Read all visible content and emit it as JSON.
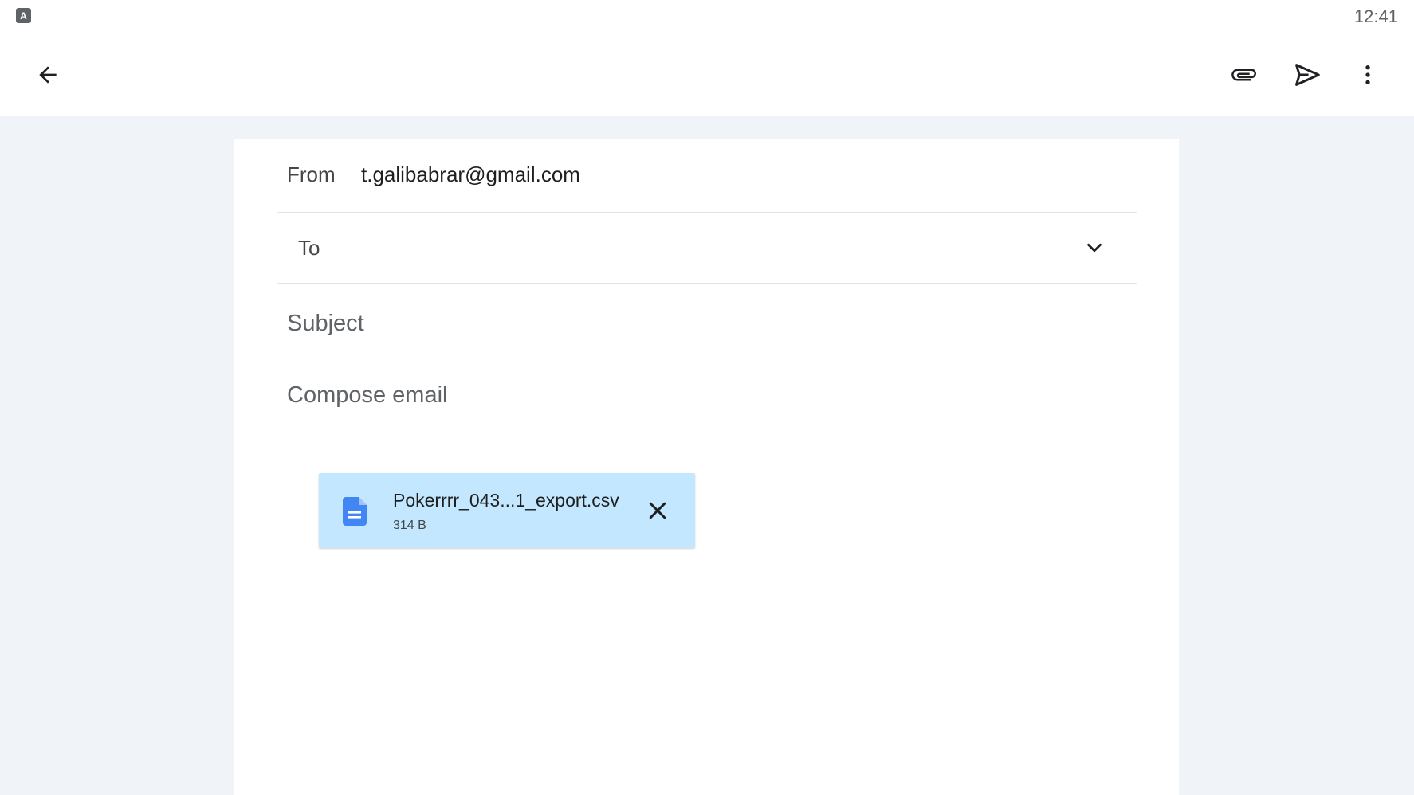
{
  "status_bar": {
    "app_icon_letter": "A",
    "time": "12:41"
  },
  "toolbar": {
    "back_icon": "arrow-back-icon",
    "attach_icon": "paperclip-icon",
    "send_icon": "send-icon",
    "more_icon": "more-vert-icon"
  },
  "compose": {
    "from_label": "From",
    "from_value": "t.galibabrar@gmail.com",
    "to_label": "To",
    "subject_placeholder": "Subject",
    "body_placeholder": "Compose email"
  },
  "attachment": {
    "file_name": "Pokerrrr_043...1_export.csv",
    "file_size": "314 B",
    "icon": "document-icon",
    "icon_color": "#4285f4",
    "chip_color": "#c2e7ff"
  },
  "colors": {
    "background": "#f0f4f9",
    "card": "#ffffff",
    "divider": "#e3e3e3"
  }
}
